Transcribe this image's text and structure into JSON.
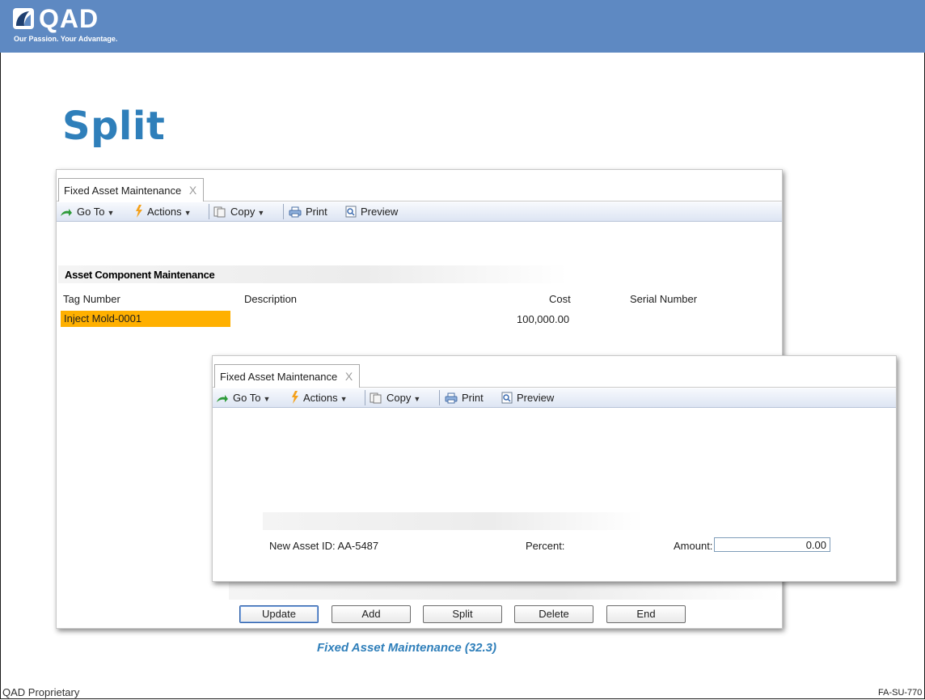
{
  "header": {
    "logo_text": "QAD",
    "tagline": "Our Passion. Your Advantage."
  },
  "slide": {
    "title": "Split",
    "caption": "Fixed Asset Maintenance (32.3)",
    "footer_left": "QAD Proprietary",
    "footer_right": "FA-SU-770"
  },
  "colors": {
    "header_bar": "#5e89c2",
    "title": "#2f7fba",
    "selection": "#ffb000"
  },
  "back_window": {
    "tab_label": "Fixed Asset Maintenance",
    "tab_close": "X",
    "toolbar": {
      "goto": "Go To",
      "actions": "Actions",
      "copy": "Copy",
      "print": "Print",
      "preview": "Preview"
    },
    "section_title": "Asset Component Maintenance",
    "columns": [
      "Tag Number",
      "Description",
      "Cost",
      "Serial Number"
    ],
    "row": {
      "tag_number": "Inject Mold-0001",
      "description": "",
      "cost": "100,000.00",
      "serial_number": ""
    },
    "buttons": {
      "update": "Update",
      "add": "Add",
      "split": "Split",
      "delete": "Delete",
      "end": "End"
    }
  },
  "front_window": {
    "tab_label": "Fixed Asset Maintenance",
    "tab_close": "X",
    "toolbar": {
      "goto": "Go To",
      "actions": "Actions",
      "copy": "Copy",
      "print": "Print",
      "preview": "Preview"
    },
    "new_asset_label": "New Asset ID:",
    "new_asset_value": "AA-5487",
    "percent_label": "Percent:",
    "amount_label": "Amount:",
    "amount_value": "0.00"
  }
}
